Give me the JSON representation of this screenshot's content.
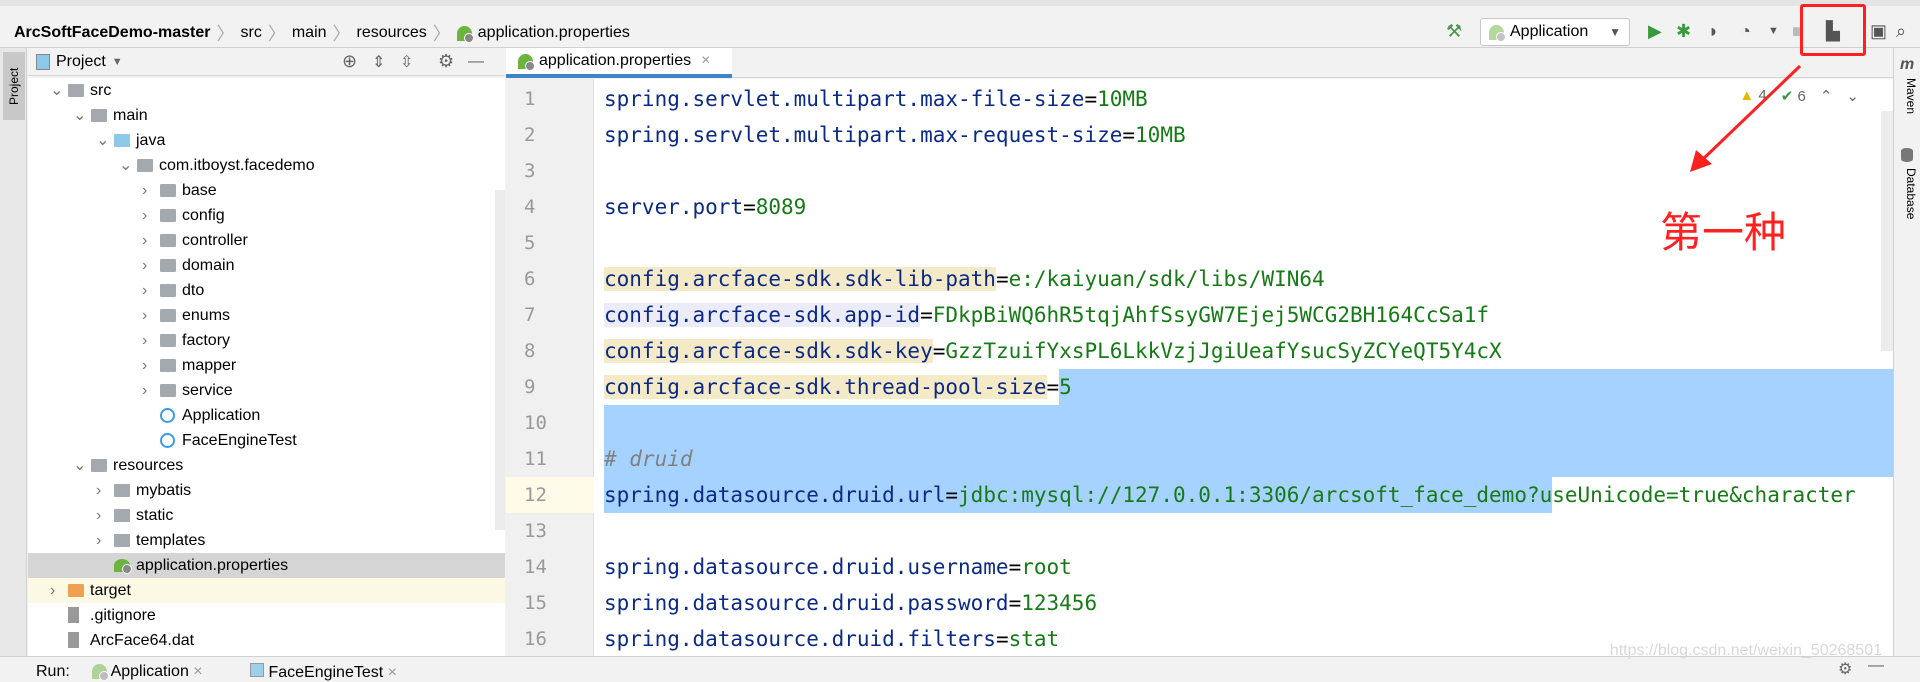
{
  "breadcrumb": {
    "project": "ArcSoftFaceDemo-master",
    "items": [
      "src",
      "main",
      "resources"
    ],
    "file": "application.properties"
  },
  "toolbar": {
    "run_config": "Application",
    "icons": [
      "hammer-icon",
      "run-icon",
      "debug-icon",
      "coverage-icon",
      "profile-icon",
      "stop-icon",
      "project-structure-icon",
      "terminal-icon",
      "search-icon"
    ]
  },
  "left_stripe": {
    "label": "Project"
  },
  "project_panel": {
    "title": "Project"
  },
  "tree": [
    {
      "label": "src",
      "level": 1,
      "type": "folder",
      "expanded": true
    },
    {
      "label": "main",
      "level": 2,
      "type": "folder",
      "expanded": true
    },
    {
      "label": "java",
      "level": 3,
      "type": "folder-blue",
      "expanded": true
    },
    {
      "label": "com.itboyst.facedemo",
      "level": 4,
      "type": "package",
      "expanded": true
    },
    {
      "label": "base",
      "level": 5,
      "type": "package",
      "expanded": false
    },
    {
      "label": "config",
      "level": 5,
      "type": "package",
      "expanded": false
    },
    {
      "label": "controller",
      "level": 5,
      "type": "package",
      "expanded": false
    },
    {
      "label": "domain",
      "level": 5,
      "type": "package",
      "expanded": false
    },
    {
      "label": "dto",
      "level": 5,
      "type": "package",
      "expanded": false
    },
    {
      "label": "enums",
      "level": 5,
      "type": "package",
      "expanded": false
    },
    {
      "label": "factory",
      "level": 5,
      "type": "package",
      "expanded": false
    },
    {
      "label": "mapper",
      "level": 5,
      "type": "package",
      "expanded": false
    },
    {
      "label": "service",
      "level": 5,
      "type": "package",
      "expanded": false
    },
    {
      "label": "Application",
      "level": 5,
      "type": "class"
    },
    {
      "label": "FaceEngineTest",
      "level": 5,
      "type": "class"
    },
    {
      "label": "resources",
      "level": 2,
      "type": "folder",
      "expanded": true
    },
    {
      "label": "mybatis",
      "level": 3,
      "type": "folder",
      "expanded": false
    },
    {
      "label": "static",
      "level": 3,
      "type": "folder",
      "expanded": false
    },
    {
      "label": "templates",
      "level": 3,
      "type": "folder",
      "expanded": false
    },
    {
      "label": "application.properties",
      "level": 3,
      "type": "spring",
      "selected": true
    },
    {
      "label": "target",
      "level": 1,
      "type": "folder-orange",
      "expanded": false
    },
    {
      "label": ".gitignore",
      "level": 1,
      "type": "file"
    },
    {
      "label": "ArcFace64.dat",
      "level": 1,
      "type": "file"
    }
  ],
  "editor": {
    "tab": "application.properties",
    "warnings": "4",
    "typos": "6",
    "lines": [
      {
        "n": "1",
        "key": "spring.servlet.multipart.max-file-size",
        "eq": "=",
        "val": "10MB"
      },
      {
        "n": "2",
        "key": "spring.servlet.multipart.max-request-size",
        "eq": "=",
        "val": "10MB"
      },
      {
        "n": "3"
      },
      {
        "n": "4",
        "key": "server.port",
        "eq": "=",
        "val": "8089"
      },
      {
        "n": "5"
      },
      {
        "n": "6",
        "key": "config.arcface-sdk.sdk-lib-path",
        "eq": "=",
        "val": "e:/kaiyuan/sdk/libs/WIN64"
      },
      {
        "n": "7",
        "key": "config.arcface-sdk.app-id",
        "eq": "=",
        "val": "FDkpBiWQ6hR5tqjAhfSsyGW7Ejej5WCG2BH164CcSa1f"
      },
      {
        "n": "8",
        "key": "config.arcface-sdk.sdk-key",
        "eq": "=",
        "val": "GzzTzuifYxsPL6LkkVzjJgiUeafYsucSyZCYeQT5Y4cX"
      },
      {
        "n": "9",
        "key": "config.arcface-sdk.thread-pool-size",
        "eq": "=",
        "val": "5"
      },
      {
        "n": "10"
      },
      {
        "n": "11",
        "comment": "# druid"
      },
      {
        "n": "12",
        "key": "spring.datasource.druid.url",
        "eq": "=",
        "val": "jdbc:mysql://127.0.0.1:3306/arcsoft_face_demo?useUnicode=true&character"
      },
      {
        "n": "13"
      },
      {
        "n": "14",
        "key": "spring.datasource.druid.username",
        "eq": "=",
        "val": "root"
      },
      {
        "n": "15",
        "key": "spring.datasource.druid.password",
        "eq": "=",
        "val": "123456"
      },
      {
        "n": "16",
        "key": "spring.datasource.druid.filters",
        "eq": "=",
        "val": "stat"
      }
    ]
  },
  "right_stripe": {
    "maven": "Maven",
    "database": "Database"
  },
  "annotation": {
    "text": "第一种",
    "color": "#ff2020"
  },
  "run_bar": {
    "label": "Run:",
    "tabs": [
      "Application",
      "FaceEngineTest"
    ]
  },
  "watermark": "https://blog.csdn.net/weixin_50268501",
  "colors": {
    "selection": "#a6d2ff",
    "key": "#0b2a85",
    "value": "#167a16",
    "accent": "#4083c9"
  }
}
